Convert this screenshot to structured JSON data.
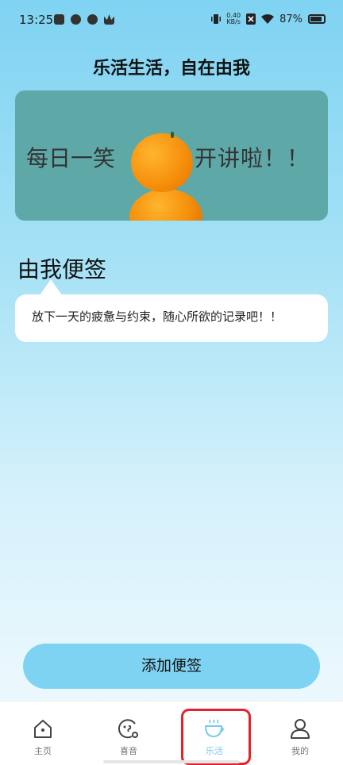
{
  "status_bar": {
    "time": "13:25",
    "net_speed_value": "0.40",
    "net_speed_unit": "KB/s",
    "battery_percent": "87%"
  },
  "page": {
    "title": "乐活生活，自在由我"
  },
  "banner": {
    "text_left": "每日一笑",
    "text_right": "开讲啦！！"
  },
  "notes": {
    "section_title": "由我便签",
    "bubble_text": "放下一天的疲惫与约束，随心所欲的记录吧！！"
  },
  "actions": {
    "add_note_label": "添加便签"
  },
  "tabbar": {
    "items": [
      {
        "label": "主页",
        "icon": "home-icon"
      },
      {
        "label": "喜音",
        "icon": "music-icon"
      },
      {
        "label": "乐活",
        "icon": "coffee-cup-icon",
        "active": true
      },
      {
        "label": "我的",
        "icon": "person-icon"
      }
    ]
  },
  "colors": {
    "accent": "#7fd3f2",
    "active_tab": "#79c9e9",
    "highlight_box": "#e3222a"
  }
}
